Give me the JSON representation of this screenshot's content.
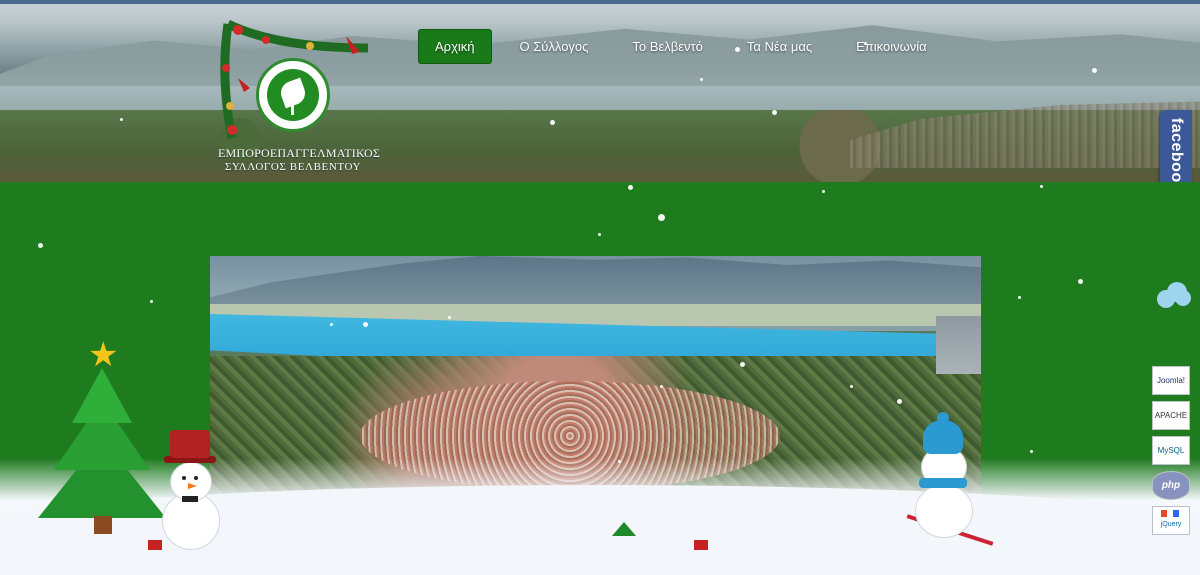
{
  "logo": {
    "caption_line1": "ΕΜΠΟΡΟΕΠΑΓΓΕΛΜΑΤΙΚΟΣ",
    "caption_line2": "ΣΥΛΛΟΓΟΣ ΒΕΛΒΕΝΤΟΥ"
  },
  "nav": {
    "items": [
      {
        "label": "Αρχική",
        "active": true
      },
      {
        "label": "Ο Σύλλογος",
        "active": false
      },
      {
        "label": "Το Βελβεντό",
        "active": false
      },
      {
        "label": "Τα Νέα μας",
        "active": false
      },
      {
        "label": "Επικοινωνία",
        "active": false
      }
    ]
  },
  "social": {
    "facebook_label": "facebook"
  },
  "badges": [
    {
      "icon": "joomla-icon",
      "label": "Joomla!"
    },
    {
      "icon": "apache-icon",
      "label": "APACHE"
    },
    {
      "icon": "mysql-icon",
      "label": "MySQL"
    },
    {
      "icon": "php-icon",
      "label": "php"
    },
    {
      "icon": "html5-css3-jquery-icon",
      "label": "jQuery"
    }
  ],
  "colors": {
    "main_background": "#1e7b1e",
    "nav_active": "#1a7a1a",
    "facebook": "#3b5998"
  }
}
